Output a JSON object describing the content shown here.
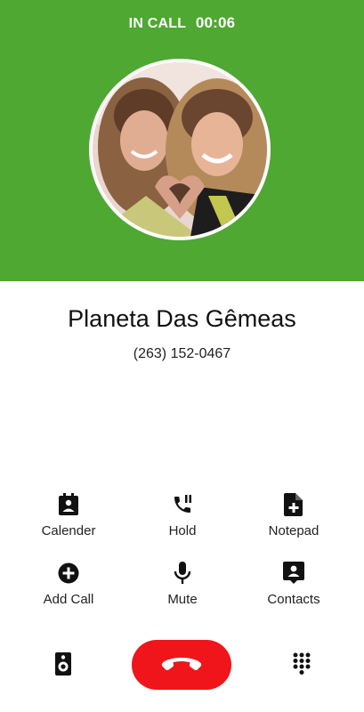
{
  "header": {
    "status_label": "IN CALL",
    "timer": "00:06",
    "accent_color": "#4ea832"
  },
  "contact": {
    "name": "Planeta Das Gêmeas",
    "number": "(263) 152-0467"
  },
  "actions": [
    {
      "label": "Calender",
      "icon": "calendar-icon"
    },
    {
      "label": "Hold",
      "icon": "phone-paused-icon"
    },
    {
      "label": "Notepad",
      "icon": "note-add-icon"
    },
    {
      "label": "Add Call",
      "icon": "add-circle-icon"
    },
    {
      "label": "Mute",
      "icon": "microphone-icon"
    },
    {
      "label": "Contacts",
      "icon": "contact-card-icon"
    }
  ],
  "bottom_bar": {
    "speaker_icon": "speaker-icon",
    "end_call_icon": "end-call-icon",
    "end_call_color": "#f0151b",
    "dialpad_icon": "dialpad-icon"
  }
}
